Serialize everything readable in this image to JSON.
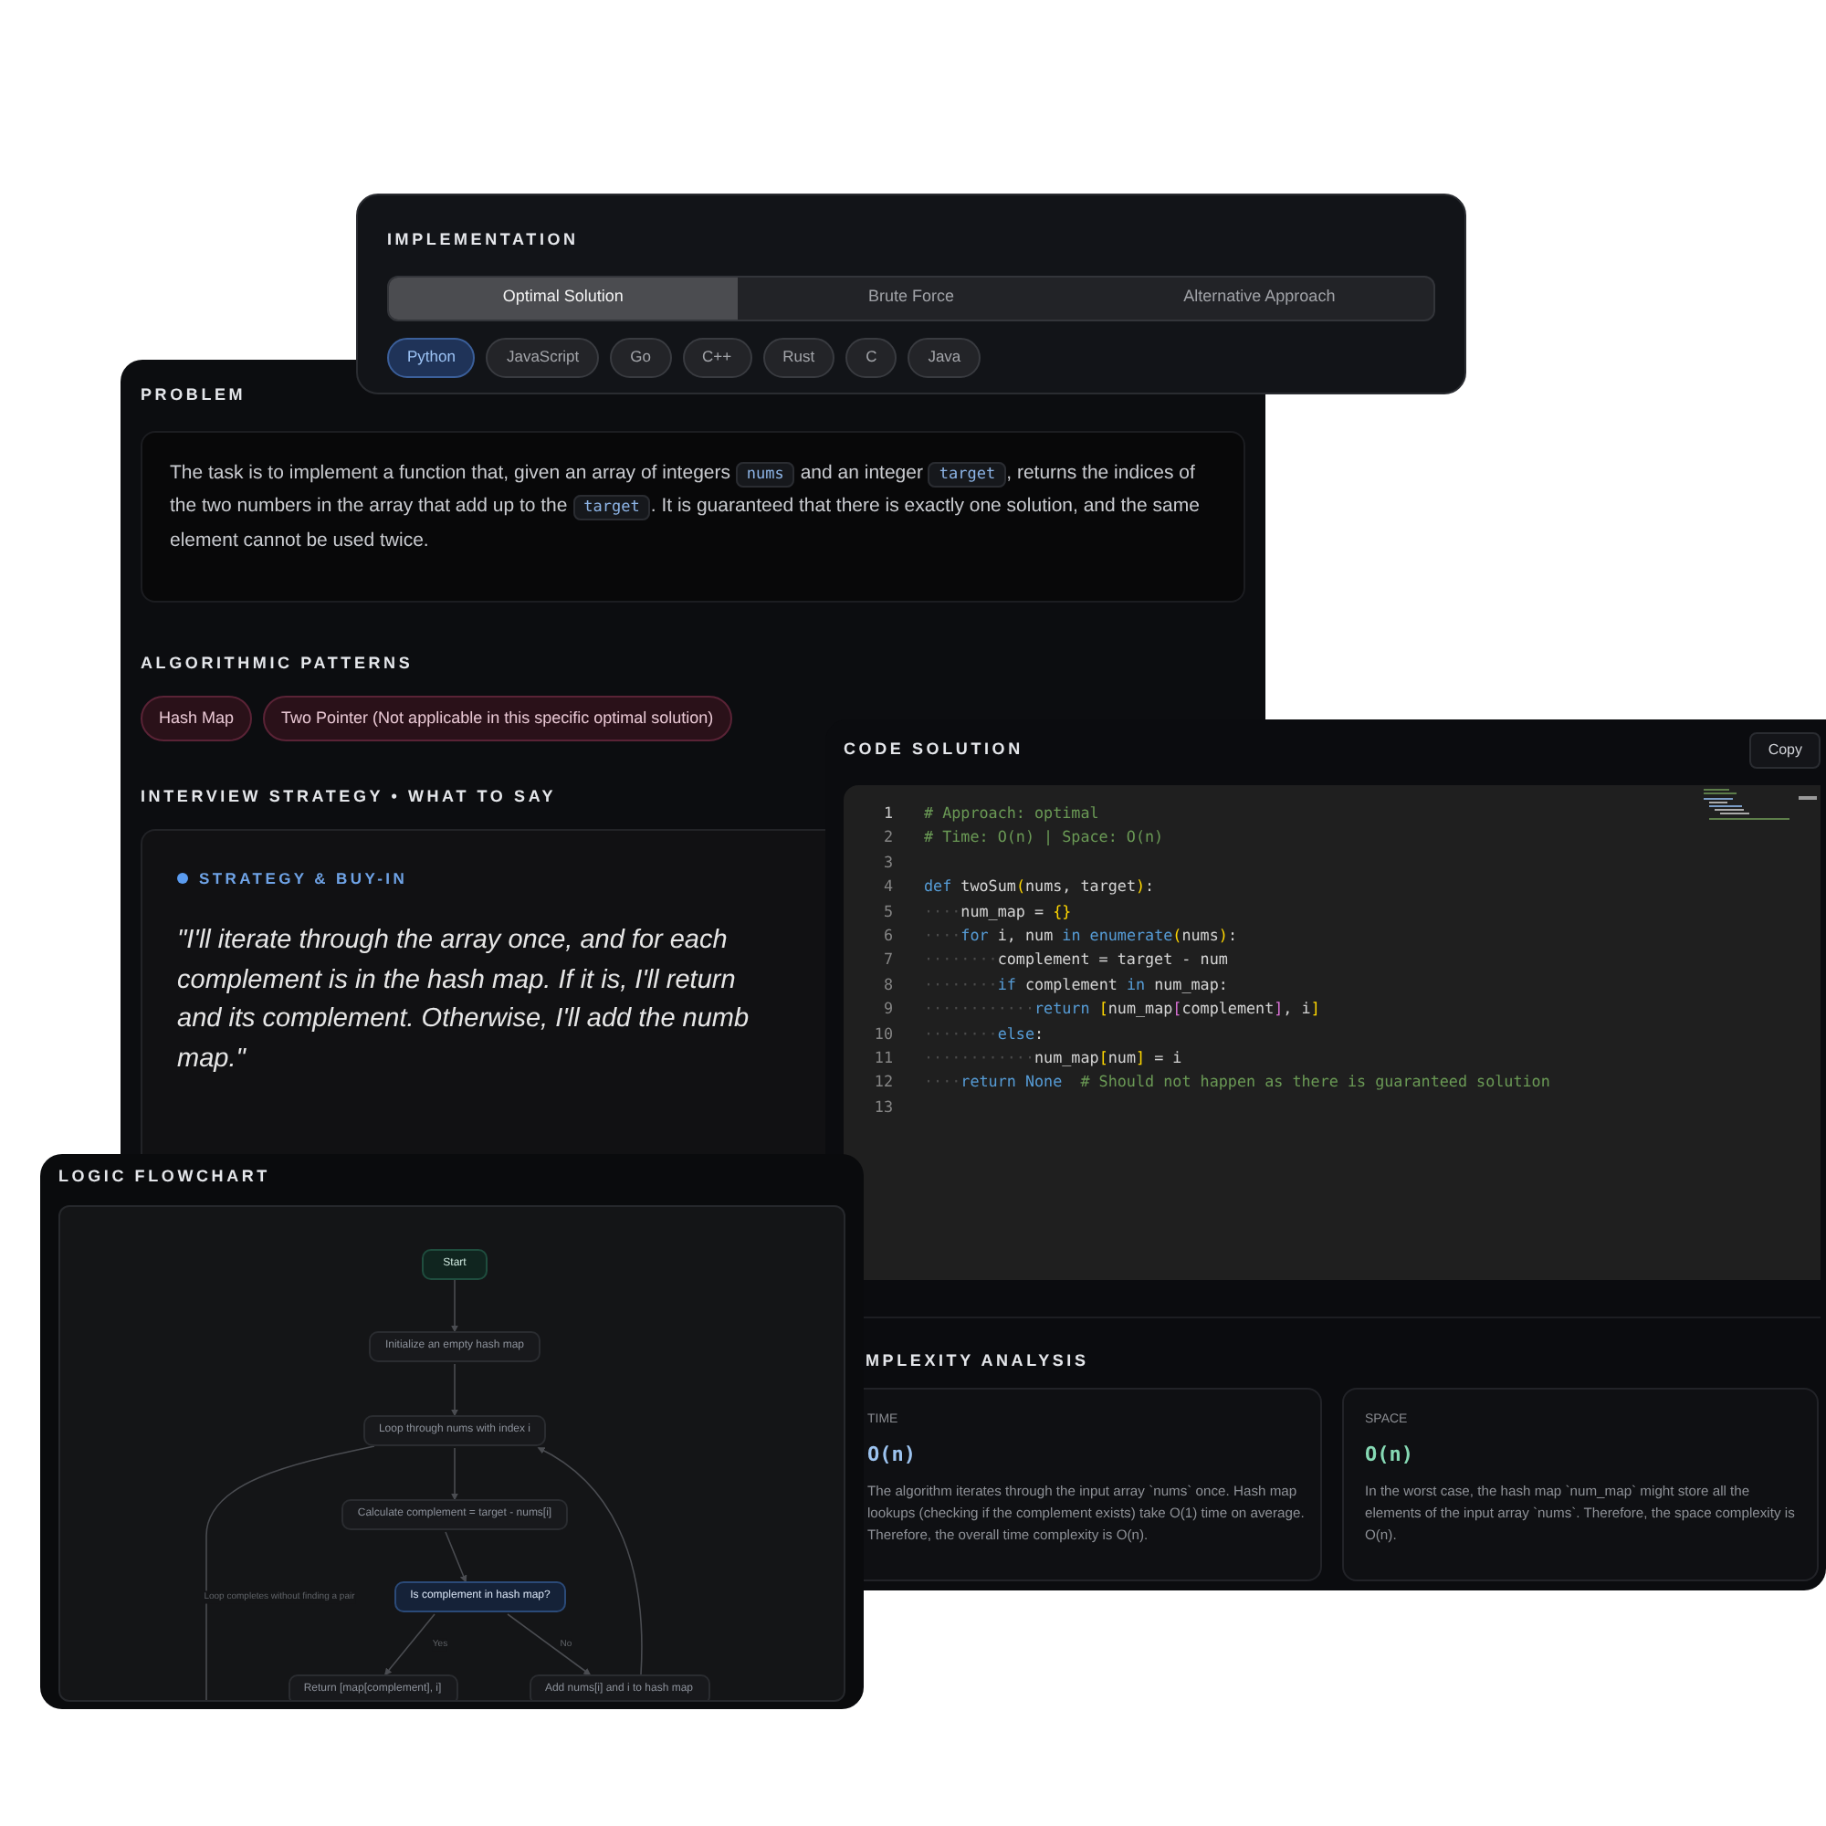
{
  "implementation": {
    "title": "IMPLEMENTATION",
    "tabs": [
      {
        "label": "Optimal Solution",
        "selected": true
      },
      {
        "label": "Brute Force",
        "selected": false
      },
      {
        "label": "Alternative Approach",
        "selected": false
      }
    ],
    "languages": [
      {
        "label": "Python",
        "selected": true
      },
      {
        "label": "JavaScript",
        "selected": false
      },
      {
        "label": "Go",
        "selected": false
      },
      {
        "label": "C++",
        "selected": false
      },
      {
        "label": "Rust",
        "selected": false
      },
      {
        "label": "C",
        "selected": false
      },
      {
        "label": "Java",
        "selected": false
      }
    ]
  },
  "problem": {
    "title": "PROBLEM",
    "text": [
      {
        "kind": "text",
        "text": "The task is to implement a function that, given an array of integers "
      },
      {
        "kind": "code",
        "text": "nums"
      },
      {
        "kind": "text",
        "text": " and an integer "
      },
      {
        "kind": "code",
        "text": "target"
      },
      {
        "kind": "text",
        "text": ", returns the indices of the two numbers in the array that add up to the "
      },
      {
        "kind": "code",
        "text": "target"
      },
      {
        "kind": "text",
        "text": ". It is guaranteed that there is exactly one solution, and the same element cannot be used twice."
      }
    ],
    "patterns_title": "ALGORITHMIC PATTERNS",
    "patterns": [
      "Hash Map",
      "Two Pointer (Not applicable in this specific optimal solution)"
    ],
    "strategy_title": "INTERVIEW STRATEGY • WHAT TO SAY",
    "strategy": {
      "label": "STRATEGY & BUY-IN",
      "quote_lines": [
        "\"I'll iterate through the array once, and for each",
        "complement is in the hash map. If it is, I'll return",
        "and its complement. Otherwise, I'll add the numb",
        "map.\""
      ]
    }
  },
  "code_solution": {
    "title": "CODE SOLUTION",
    "copy_button": "Copy",
    "lines": [
      {
        "number": "1",
        "tokens": [
          {
            "kind": "comment",
            "text": "# Approach: optimal"
          }
        ]
      },
      {
        "number": "2",
        "tokens": [
          {
            "kind": "comment",
            "text": "# Time: O(n) | Space: O(n)"
          }
        ]
      },
      {
        "number": "3"
      },
      {
        "number": "4",
        "tokens": [
          {
            "kind": "keyword",
            "text": "def"
          },
          {
            "kind": "plain",
            "text": " twoSum"
          },
          {
            "kind": "bracket",
            "text": "("
          },
          {
            "kind": "plain",
            "text": "nums, target"
          },
          {
            "kind": "bracket",
            "text": ")"
          },
          {
            "kind": "plain",
            "text": ":"
          }
        ]
      },
      {
        "number": "5",
        "tokens": [
          {
            "kind": "whitespace",
            "text": "····"
          },
          {
            "kind": "plain",
            "text": "num_map = "
          },
          {
            "kind": "bracket",
            "text": "{}"
          }
        ]
      },
      {
        "number": "6",
        "tokens": [
          {
            "kind": "whitespace",
            "text": "····"
          },
          {
            "kind": "keyword",
            "text": "for"
          },
          {
            "kind": "plain",
            "text": " i, num "
          },
          {
            "kind": "keyword",
            "text": "in"
          },
          {
            "kind": "keyword",
            "text": " enumerate"
          },
          {
            "kind": "bracket",
            "text": "("
          },
          {
            "kind": "plain",
            "text": "nums"
          },
          {
            "kind": "bracket",
            "text": ")"
          },
          {
            "kind": "plain",
            "text": ":"
          }
        ]
      },
      {
        "number": "7",
        "tokens": [
          {
            "kind": "whitespace",
            "text": "········"
          },
          {
            "kind": "plain",
            "text": "complement = target - num"
          }
        ]
      },
      {
        "number": "8",
        "tokens": [
          {
            "kind": "whitespace",
            "text": "········"
          },
          {
            "kind": "keyword",
            "text": "if"
          },
          {
            "kind": "plain",
            "text": " complement "
          },
          {
            "kind": "keyword",
            "text": "in"
          },
          {
            "kind": "plain",
            "text": " num_map:"
          }
        ]
      },
      {
        "number": "9",
        "tokens": [
          {
            "kind": "whitespace",
            "text": "············"
          },
          {
            "kind": "keyword",
            "text": "return "
          },
          {
            "kind": "bracket",
            "text": "["
          },
          {
            "kind": "plain",
            "text": "num_map"
          },
          {
            "kind": "bracket2",
            "text": "["
          },
          {
            "kind": "plain",
            "text": "complement"
          },
          {
            "kind": "bracket2",
            "text": "]"
          },
          {
            "kind": "plain",
            "text": ", i"
          },
          {
            "kind": "bracket",
            "text": "]"
          }
        ]
      },
      {
        "number": "10",
        "tokens": [
          {
            "kind": "whitespace",
            "text": "········"
          },
          {
            "kind": "keyword",
            "text": "else"
          },
          {
            "kind": "plain",
            "text": ":"
          }
        ]
      },
      {
        "number": "11",
        "tokens": [
          {
            "kind": "whitespace",
            "text": "············"
          },
          {
            "kind": "plain",
            "text": "num_map"
          },
          {
            "kind": "bracket",
            "text": "["
          },
          {
            "kind": "plain",
            "text": "num"
          },
          {
            "kind": "bracket",
            "text": "]"
          },
          {
            "kind": "plain",
            "text": " = i"
          }
        ]
      },
      {
        "number": "12",
        "tokens": [
          {
            "kind": "whitespace",
            "text": "····"
          },
          {
            "kind": "keyword",
            "text": "return "
          },
          {
            "kind": "keyword",
            "text": "None"
          },
          {
            "kind": "comment",
            "text": "  # Should not happen as there is guaranteed solution"
          }
        ]
      },
      {
        "number": "13"
      }
    ]
  },
  "complexity": {
    "title": "MPLEXITY ANALYSIS",
    "cards": [
      {
        "label": "TIME",
        "value": "O(n)",
        "color": "#9cc3ef",
        "description": "The algorithm iterates through the input array `nums` once. Hash map lookups (checking if the complement exists) take O(1) time on average. Therefore, the overall time complexity is O(n)."
      },
      {
        "label": "SPACE",
        "value": "O(n)",
        "color": "#86d9b4",
        "description": "In the worst case, the hash map `num_map` might store all the elements of the input array `nums`. Therefore, the space complexity is O(n)."
      }
    ]
  },
  "flowchart": {
    "title": "LOGIC FLOWCHART",
    "nodes": [
      {
        "label": "Start",
        "kind": "start"
      },
      {
        "label": "Initialize an empty hash map",
        "kind": "process"
      },
      {
        "label": "Loop through nums with index i",
        "kind": "process"
      },
      {
        "label": "Calculate complement = target - nums[i]",
        "kind": "process"
      },
      {
        "label": "Is complement in hash map?",
        "kind": "decision"
      },
      {
        "label": "Return [map[complement], i]",
        "kind": "process"
      },
      {
        "label": "Add nums[i] and i to hash map",
        "kind": "process"
      }
    ],
    "edge_labels": [
      "Loop completes without finding a pair",
      "Yes",
      "No"
    ]
  }
}
